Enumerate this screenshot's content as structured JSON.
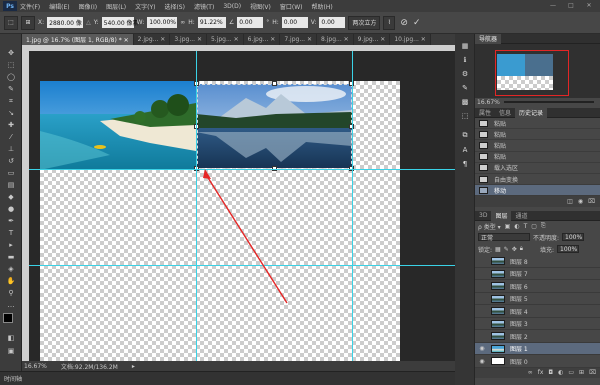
{
  "app": {
    "logo": "Ps"
  },
  "menu": [
    "文件(F)",
    "编辑(E)",
    "图像(I)",
    "图层(L)",
    "文字(Y)",
    "选择(S)",
    "滤镜(T)",
    "3D(D)",
    "视图(V)",
    "窗口(W)",
    "帮助(H)"
  ],
  "window_controls": [
    "—",
    "□",
    "✕"
  ],
  "options": {
    "x_label": "X:",
    "x_value": "2880.00 像",
    "y_label": "Y:",
    "y_value": "540.00 像素",
    "w_label": "W:",
    "w_value": "100.00%",
    "h_label": "H:",
    "h_value": "91.22%",
    "angle_value": "0.00",
    "h2_label": "H:",
    "h2_value": "0.00",
    "v_label": "V:",
    "v_value": "0.00",
    "interp": "两次立方",
    "cancel_glyph": "⊘",
    "commit_glyph": "✓"
  },
  "doc_tabs": [
    {
      "label": "1.jpg @ 16.7% (图层 1, RGB/8) * ✕",
      "active": true
    },
    {
      "label": "2.jpg... ✕",
      "active": false
    },
    {
      "label": "3.jpg... ✕",
      "active": false
    },
    {
      "label": "5.jpg... ✕",
      "active": false
    },
    {
      "label": "6.jpg... ✕",
      "active": false
    },
    {
      "label": "7.jpg... ✕",
      "active": false
    },
    {
      "label": "8.jpg... ✕",
      "active": false
    },
    {
      "label": "9.jpg... ✕",
      "active": false
    },
    {
      "label": "10.jpg... ✕",
      "active": false
    }
  ],
  "status": {
    "zoom": "16.67%",
    "doc": "文档:92.2M/136.2M"
  },
  "timeline": {
    "label": "时间轴"
  },
  "navigator": {
    "tab": "导航器",
    "zoom": "16.67%"
  },
  "history": {
    "tabs": [
      "属性",
      "信息",
      "历史记录"
    ],
    "items": [
      {
        "label": "粘贴",
        "selected": false
      },
      {
        "label": "粘贴",
        "selected": false
      },
      {
        "label": "粘贴",
        "selected": false
      },
      {
        "label": "粘贴",
        "selected": false
      },
      {
        "label": "载入选区",
        "selected": false
      },
      {
        "label": "自由变换",
        "selected": false
      },
      {
        "label": "移动",
        "selected": true
      }
    ]
  },
  "layers": {
    "tabs": [
      "3D",
      "图层",
      "通道"
    ],
    "mode": "正常",
    "opacity_label": "不透明度:",
    "opacity": "100%",
    "lock_label": "锁定:",
    "fill_label": "填充:",
    "fill": "100%",
    "items": [
      {
        "label": "图层 8",
        "thumb": "lake",
        "selected": false
      },
      {
        "label": "图层 7",
        "thumb": "lake",
        "selected": false
      },
      {
        "label": "图层 6",
        "thumb": "lake",
        "selected": false
      },
      {
        "label": "图层 5",
        "thumb": "lake",
        "selected": false
      },
      {
        "label": "图层 4",
        "thumb": "lake",
        "selected": false
      },
      {
        "label": "图层 3",
        "thumb": "lake",
        "selected": false
      },
      {
        "label": "图层 2",
        "thumb": "lake",
        "selected": false
      },
      {
        "label": "图层 1",
        "thumb": "beach",
        "selected": true
      },
      {
        "label": "图层 0",
        "thumb": "plain",
        "selected": false
      }
    ]
  },
  "colors": {
    "accent": "#5c6a7e",
    "guide": "#3ad2e6",
    "arrow": "#e52626"
  }
}
